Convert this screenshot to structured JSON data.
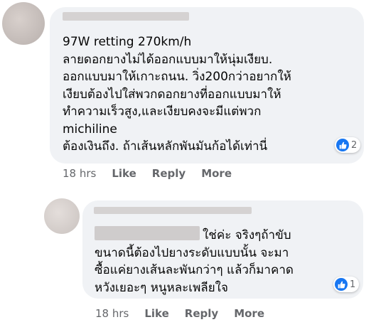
{
  "comments": [
    {
      "text_lines": [
        "97W retting 270km/h",
        "ลายดอกยางไม่ได้ออกแบบมาให้นุ่มเงียบ.",
        "ออกแบบมาให้เกาะถนน. วิ่ง200กว่าอยากให้",
        "เงียบต้องไปใส่พวกดอกยางที่ออกแบบมาให้",
        "ทำความเร็วสูง,และเงียบคงจะมีแต่พวก",
        "michiline",
        "ต้องเงินถึง. ถ้าเส้นหลักพันมันก้อได้เท่านี่"
      ],
      "reaction_count": "2",
      "time": "18 hrs",
      "like_label": "Like",
      "reply_label": "Reply",
      "more_label": "More"
    },
    {
      "text_lines": [
        "ใช่ค่ะ จริงๆถ้าขับ",
        "ขนาดนี้ต้องไปยางระดับแบบนั้น จะมา",
        "ซื้อแค่ยางเส้นละพันกว่าๆ แล้วก็มาคาด",
        "หวังเยอะๆ หนูหละเพลียใจ"
      ],
      "reaction_count": "1",
      "time": "18 hrs",
      "like_label": "Like",
      "reply_label": "Reply",
      "more_label": "More"
    }
  ],
  "colors": {
    "bubble": "#f0f2f5",
    "text": "#050505",
    "meta": "#65676b",
    "like_blue": "#1877f2"
  },
  "icons": {
    "reaction": "thumbs-up-icon"
  }
}
